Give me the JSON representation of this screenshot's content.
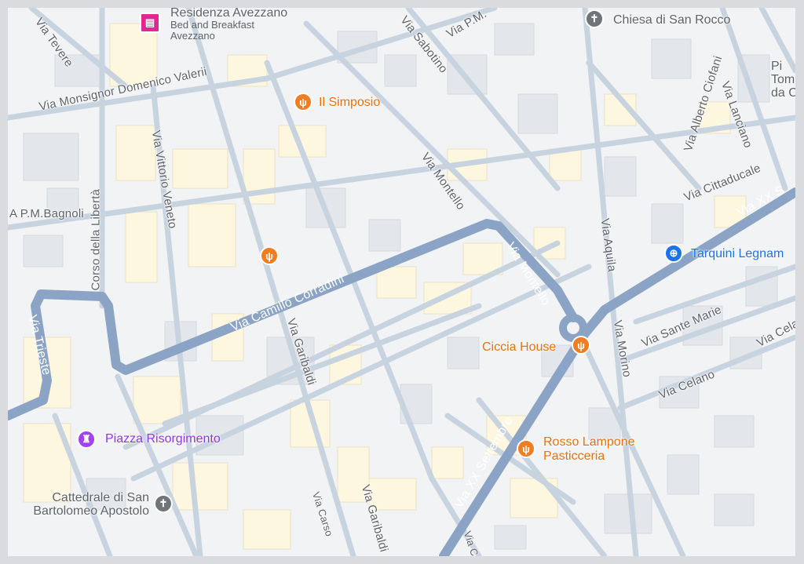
{
  "map": {
    "streets": {
      "via_tevere": "Via Tevere",
      "via_sabotino": "Via Sabotino",
      "via_pm_top": "Via P.M.",
      "via_valerii": "Via Monsignor Domenico Valerii",
      "corso_liberta": "Corso della Libertà",
      "via_vittorio_veneto": "Via Vittorio Veneto",
      "via_pm_bagnoli": "A P.M.Bagnoli",
      "via_montello_upper": "Via Montello",
      "via_montello_lower": "Via Montello",
      "via_camillo_corradini": "Via Camillo Corradini",
      "via_garibaldi_upper": "Via Garibaldi",
      "via_garibaldi_lower": "Via Garibaldi",
      "via_trieste": "Via Trieste",
      "via_aquila": "Via Aquila",
      "via_morino": "Via Morino",
      "via_alberto_ciofani": "Via Alberto Ciofani",
      "via_lanciano": "Via Lanciano",
      "via_cittaducale": "Via Cittaducale",
      "via_xx_settembre_ne": "Via XX S",
      "via_xx_settembre_sw": "Via XX Settembre",
      "via_sante_marie": "Via Sante Marie",
      "via_celano_1": "Via Celano",
      "via_celano_2": "Via Cela",
      "via_carso": "Via Carso",
      "via_cu": "Via Cu"
    },
    "pois": {
      "residenza_title": "Residenza Avezzano",
      "residenza_sub1": "Bed and Breakfast",
      "residenza_sub2": "Avezzano",
      "il_simposio": "Il Simposio",
      "ciccia_house": "Ciccia House",
      "rosso_lampone_1": "Rosso Lampone",
      "rosso_lampone_2": "Pasticceria",
      "piazza_risorgimento": "Piazza Risorgimento",
      "cattedrale_1": "Cattedrale di San",
      "cattedrale_2": "Bartolomeo Apostolo",
      "chiesa_san_rocco": "Chiesa di San Rocco",
      "tarquini": "Tarquini Legnam",
      "edge_pi_1": "Pi",
      "edge_pi_2": "Tom",
      "edge_pi_3": "da C"
    },
    "icons": {
      "food": "restaurant-icon",
      "hotel": "hotel-icon",
      "church": "church-icon",
      "landmark": "landmark-icon",
      "shop": "shopping-icon"
    },
    "colors": {
      "background": "#f1f3f4",
      "building": "#fef7e0",
      "building_gray": "#e8eaed",
      "road_minor": "#c5d0dd",
      "road_major": "#8ba3c5",
      "food": "#e8710a",
      "purple": "#9334e6",
      "blue": "#1a73e8"
    }
  }
}
